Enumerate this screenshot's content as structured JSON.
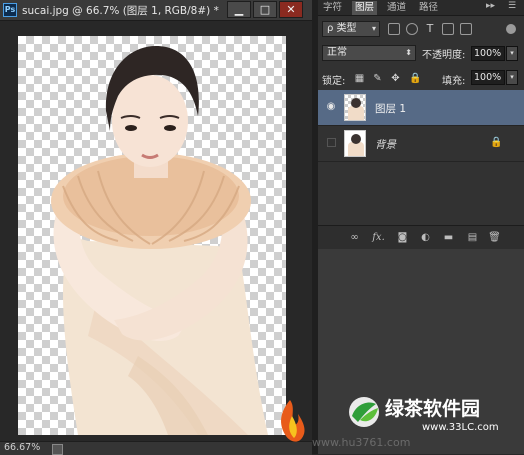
{
  "document": {
    "title": "sucai.jpg @ 66.7% (图层 1, RGB/8#) *",
    "app_icon_text": "Ps",
    "window_buttons": {
      "minimize": "▁",
      "maximize": "□",
      "close": "✕"
    },
    "zoom": "66.67%"
  },
  "panel": {
    "tabs": [
      {
        "label": "字符",
        "active": false
      },
      {
        "label": "图层",
        "active": true
      },
      {
        "label": "通道",
        "active": false
      },
      {
        "label": "路径",
        "active": false
      }
    ],
    "tab_arrows": "▸▸",
    "tab_menu": "☰",
    "filter_dropdown": "ρ 类型",
    "blend_mode": "正常",
    "opacity_label": "不透明度:",
    "opacity_value": "100%",
    "lock_label": "锁定:",
    "fill_label": "填充:",
    "fill_value": "100%",
    "layers": [
      {
        "name": "图层 1",
        "selected": true,
        "visible": true
      },
      {
        "name": "背景",
        "selected": false,
        "visible": false,
        "locked": true
      }
    ],
    "bottom_icons": [
      "link-icon",
      "fx-icon",
      "mask-icon",
      "adjustment-icon",
      "group-folder-icon",
      "new-layer-icon",
      "trash-icon"
    ],
    "bottom_fx": "fx."
  },
  "watermark": {
    "brand": "绿茶软件园",
    "url": "www.33LC.com",
    "faint_text": "www.hu3761.com"
  },
  "colors": {
    "selected_layer": "#566a86",
    "brand_green": "#2f9e3a"
  }
}
